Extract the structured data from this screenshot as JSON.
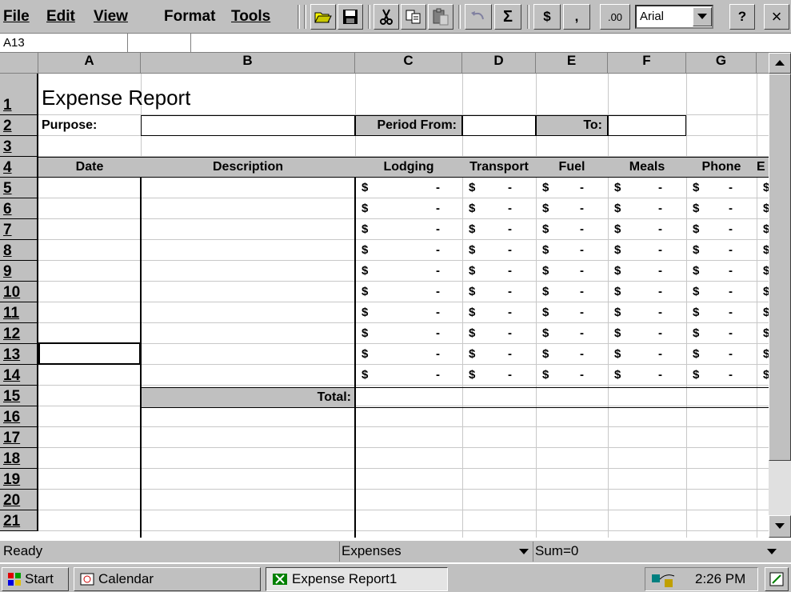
{
  "menu": {
    "file": "File",
    "edit": "Edit",
    "view": "View",
    "format": "Format",
    "tools": "Tools"
  },
  "toolbar": {
    "currency": "$",
    "comma": ",",
    "decimal": ".00",
    "font": "Arial",
    "help": "?",
    "close": "×",
    "sum": "Σ"
  },
  "namebox": {
    "value": "A13"
  },
  "columns": [
    "A",
    "B",
    "C",
    "D",
    "E",
    "F",
    "G"
  ],
  "rows": [
    "1",
    "2",
    "3",
    "4",
    "5",
    "6",
    "7",
    "8",
    "9",
    "10",
    "11",
    "12",
    "13",
    "14",
    "15",
    "16",
    "17",
    "18",
    "19",
    "20",
    "21"
  ],
  "sheet": {
    "title": "Expense Report",
    "purpose_label": "Purpose:",
    "period_from_label": "Period From:",
    "to_label": "To:",
    "headers": {
      "date": "Date",
      "description": "Description",
      "lodging": "Lodging",
      "transport": "Transport",
      "fuel": "Fuel",
      "meals": "Meals",
      "phone": "Phone",
      "more": "E"
    },
    "currency_symbol": "$",
    "empty_amount": "-",
    "total_label": "Total:"
  },
  "status": {
    "state": "Ready",
    "sheet": "Expenses",
    "sum": "Sum=0"
  },
  "taskbar": {
    "start": "Start",
    "calendar": "Calendar",
    "active": "Expense Report1",
    "clock": "2:26 PM"
  },
  "colors": {
    "chrome": "#c0c0c0",
    "gridline": "#c8c8c8"
  }
}
